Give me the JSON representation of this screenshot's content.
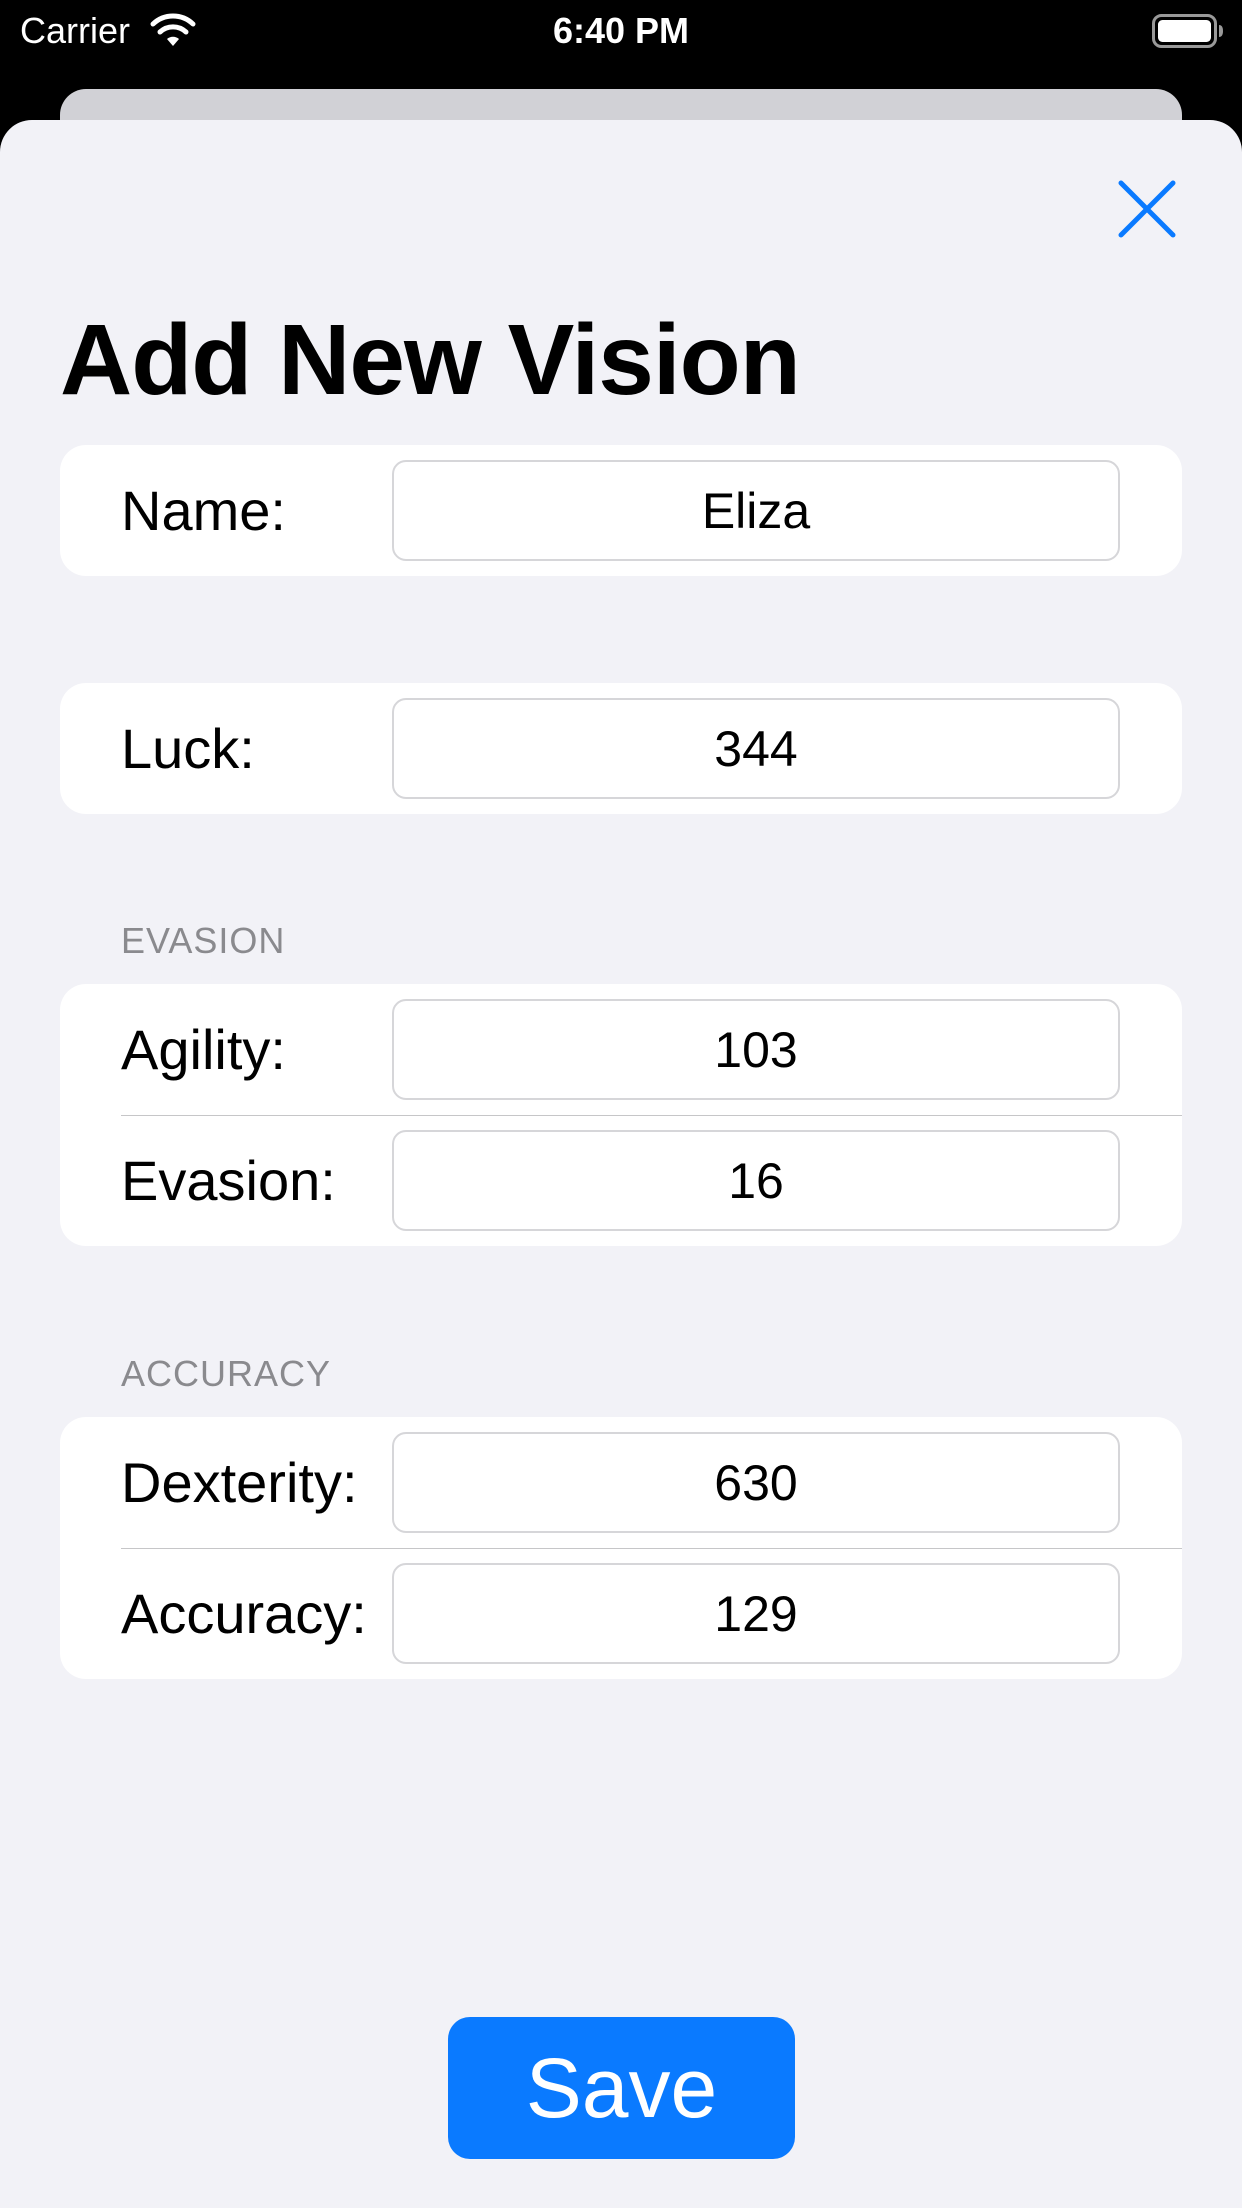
{
  "status_bar": {
    "carrier": "Carrier",
    "time": "6:40 PM",
    "wifi_icon": "wifi-icon",
    "battery_icon": "battery-full-icon"
  },
  "colors": {
    "accent": "#0a7aff",
    "background": "#f2f2f7",
    "card": "#ffffff",
    "section_header": "#8a8a8e"
  },
  "close_icon": "close-icon",
  "title": "Add New Vision",
  "form": {
    "name": {
      "label": "Name:",
      "value": "Eliza"
    },
    "luck": {
      "label": "Luck:",
      "value": "344"
    },
    "evasion_section": {
      "header": "EVASION",
      "agility": {
        "label": "Agility:",
        "value": "103"
      },
      "evasion": {
        "label": "Evasion:",
        "value": "16"
      }
    },
    "accuracy_section": {
      "header": "ACCURACY",
      "dexterity": {
        "label": "Dexterity:",
        "value": "630"
      },
      "accuracy": {
        "label": "Accuracy:",
        "value": "129"
      }
    }
  },
  "save_label": "Save"
}
